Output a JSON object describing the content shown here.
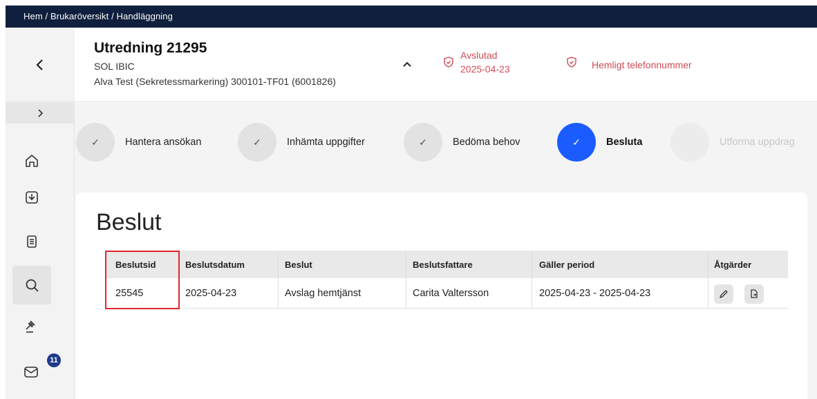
{
  "breadcrumb": "Hem / Brukaröversikt / Handläggning",
  "nav": {
    "back_icon": "chevron-left-icon",
    "expand_icon": "chevron-right-icon",
    "items": [
      {
        "name": "home-icon"
      },
      {
        "name": "inbox-icon"
      },
      {
        "name": "document-icon"
      },
      {
        "name": "search-icon",
        "active": true
      },
      {
        "name": "gavel-icon"
      },
      {
        "name": "mail-icon",
        "badge": "11"
      }
    ]
  },
  "header": {
    "title": "Utredning 21295",
    "case_type": "SOL IBIC",
    "person": "Alva Test (Sekretessmarkering) 300101-TF01 (6001826)",
    "status_label": "Avslutad",
    "status_date": "2025-04-23",
    "secret_label": "Hemligt telefonnummer",
    "alert_color": "#d14b56"
  },
  "stepper": [
    {
      "label": "Hantera ansökan",
      "state": "done"
    },
    {
      "label": "Inhämta uppgifter",
      "state": "done"
    },
    {
      "label": "Bedöma behov",
      "state": "done"
    },
    {
      "label": "Besluta",
      "state": "active"
    },
    {
      "label": "Utforma uppdrag",
      "state": "future"
    }
  ],
  "card": {
    "title": "Beslut",
    "table": {
      "headers": [
        "Beslutsid",
        "Beslutsdatum",
        "Beslut",
        "Beslutsfattare",
        "Gäller period",
        "Åtgärder"
      ],
      "rows": [
        [
          "25545",
          "2025-04-23",
          "Avslag hemtjänst",
          "Carita Valtersson",
          "2025-04-23 - 2025-04-23"
        ]
      ],
      "actions": [
        "edit-icon",
        "document-export-icon"
      ]
    }
  },
  "colors": {
    "topbar": "#0f1f3d",
    "accent": "#1a5cff",
    "highlight": "#e0262c"
  }
}
